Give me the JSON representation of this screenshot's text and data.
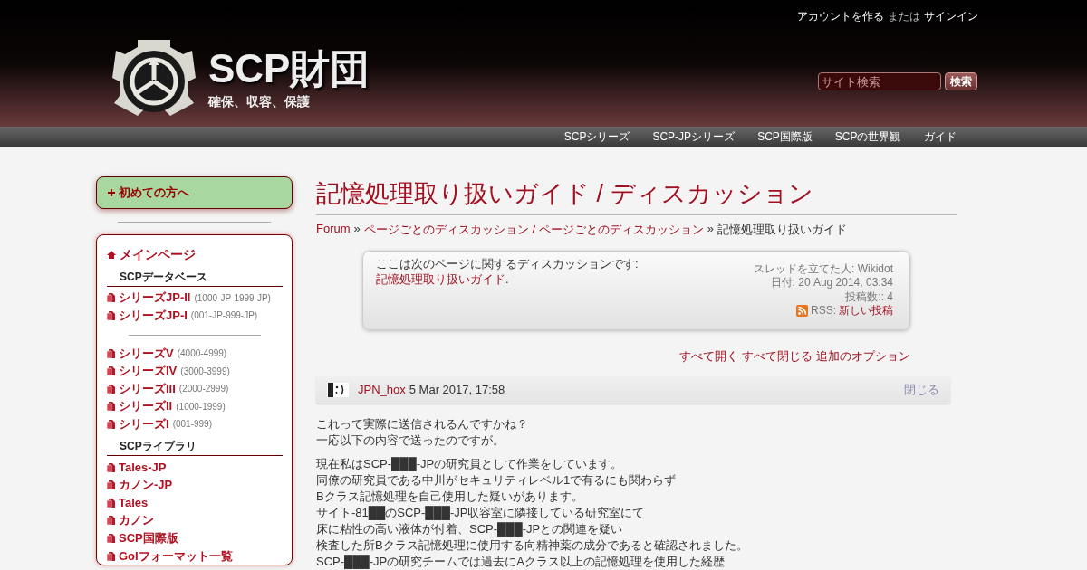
{
  "header": {
    "account_links": [
      {
        "text": "アカウントを作る",
        "kind": "link"
      },
      {
        "text": "または",
        "kind": "plain"
      },
      {
        "text": "サインイン",
        "kind": "link"
      }
    ],
    "site_title": "SCP財団",
    "tagline": "確保、収容、保護",
    "search": {
      "placeholder": "サイト検索"
    },
    "search_button": "検索"
  },
  "top_nav": [
    "SCPシリーズ",
    "SCP-JPシリーズ",
    "SCP国際版",
    "SCPの世界観",
    "ガイド"
  ],
  "sidebar": {
    "start_button": "初めての方へ",
    "items": [
      {
        "kind": "home",
        "text": "メインページ"
      },
      {
        "kind": "heading",
        "text": "SCPデータベース"
      },
      {
        "kind": "page",
        "text": "シリーズJP-II",
        "range": "(1000-JP-1999-JP)"
      },
      {
        "kind": "page",
        "text": "シリーズJP-I",
        "range": "(001-JP-999-JP)"
      },
      {
        "kind": "divider"
      },
      {
        "kind": "page",
        "text": "シリーズV",
        "range": "(4000-4999)"
      },
      {
        "kind": "page",
        "text": "シリーズIV",
        "range": "(3000-3999)"
      },
      {
        "kind": "page",
        "text": "シリーズIII",
        "range": "(2000-2999)"
      },
      {
        "kind": "page",
        "text": "シリーズII",
        "range": "(1000-1999)"
      },
      {
        "kind": "page",
        "text": "シリーズI",
        "range": "(001-999)"
      },
      {
        "kind": "heading",
        "text": "SCPライブラリ"
      },
      {
        "kind": "page",
        "text": "Tales-JP"
      },
      {
        "kind": "page",
        "text": "カノン-JP"
      },
      {
        "kind": "page",
        "text": "Tales"
      },
      {
        "kind": "page",
        "text": "カノン"
      },
      {
        "kind": "page",
        "text": "SCP国際版"
      },
      {
        "kind": "page",
        "text": "GoIフォーマット一覧"
      }
    ]
  },
  "page_title": "記憶処理取り扱いガイド / ディスカッション",
  "breadcrumb": [
    {
      "text": "Forum",
      "kind": "link"
    },
    {
      "text": "»",
      "kind": "separator"
    },
    {
      "text": "ページごとのディスカッション / ページごとのディスカッション",
      "kind": "link"
    },
    {
      "text": "»",
      "kind": "separator"
    },
    {
      "text": "記憶処理取り扱いガイド",
      "kind": "plain"
    }
  ],
  "thread_info": {
    "description": "ここは次のページに関するディスカッションです: ",
    "page_link": "記憶処理取り扱いガイド",
    "description_end": ".",
    "started_by": "スレッドを立てた人: Wikidot",
    "date": "日付: 20 Aug 2014, 03:34",
    "post_count": "投稿数:: 4",
    "rss_label": "RSS:",
    "rss_link": "新しい投稿"
  },
  "thread_options": [
    "すべて開く",
    "すべて閉じる",
    "追加のオプション"
  ],
  "post": {
    "author": "JPN_hox",
    "date": "5 Mar 2017, 17:58",
    "close": "閉じる",
    "paragraphs": [
      [
        "これって実際に送信されるんですかね？",
        "一応以下の内容で送ったのですが。"
      ],
      [
        "現在私はSCP-███-JPの研究員として作業をしています。",
        "同僚の研究員である中川がセキュリティレベル1で有るにも関わらず",
        "Bクラス記憶処理を自己使用した疑いがあります。",
        "サイト-81██のSCP-███-JP収容室に隣接している研究室にて",
        "床に粘性の高い液体が付着、SCP-███-JPとの関連を疑い",
        "検査した所Bクラス記憶処理に使用する向精神薬の成分であると確認されました。",
        "SCP-███-JPの研究チームでは過去にAクラス以上の記憶処理を使用した経歴"
      ]
    ]
  }
}
